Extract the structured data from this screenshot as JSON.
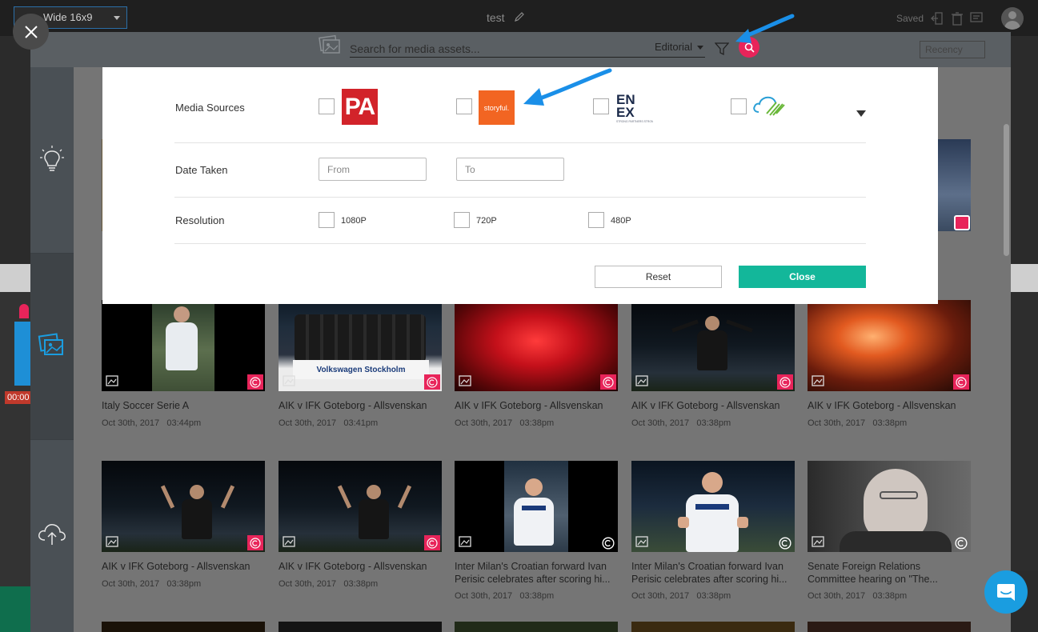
{
  "topbar": {
    "aspect_label": "Wide 16x9",
    "project_title": "test",
    "saved_label": "Saved"
  },
  "background": {
    "timecode": "00:00"
  },
  "search": {
    "placeholder": "Search for media assets...",
    "category": "Editorial",
    "sort": "Recency"
  },
  "filters": {
    "media_sources_label": "Media Sources",
    "sources": [
      {
        "name": "PA",
        "logo_text": "PA",
        "color": "#d2232a"
      },
      {
        "name": "Storyful",
        "logo_text": "storyful.",
        "color": "#f26522"
      },
      {
        "name": "ENEX",
        "logo_text": "ENEX",
        "color": "#1b2a4a",
        "tagline": "STRONG PARTNERS STRONG NEWS"
      },
      {
        "name": "Cloud source",
        "color": "#2a9fd6"
      }
    ],
    "date_taken_label": "Date Taken",
    "date_from_placeholder": "From",
    "date_to_placeholder": "To",
    "resolution_label": "Resolution",
    "resolutions": [
      "1080P",
      "720P",
      "480P"
    ],
    "reset_label": "Reset",
    "close_label": "Close"
  },
  "assets": [
    {
      "title": "Italy Soccer Serie A",
      "date": "Oct 30th, 2017",
      "time": "03:44pm"
    },
    {
      "title": "AIK v IFK Goteborg - Allsvenskan",
      "date": "Oct 30th, 2017",
      "time": "03:41pm",
      "banner": "Volkswagen Stockholm"
    },
    {
      "title": "AIK v IFK Goteborg - Allsvenskan",
      "date": "Oct 30th, 2017",
      "time": "03:38pm"
    },
    {
      "title": "AIK v IFK Goteborg - Allsvenskan",
      "date": "Oct 30th, 2017",
      "time": "03:38pm"
    },
    {
      "title": "AIK v IFK Goteborg - Allsvenskan",
      "date": "Oct 30th, 2017",
      "time": "03:38pm"
    },
    {
      "title": "AIK v IFK Goteborg - Allsvenskan",
      "date": "Oct 30th, 2017",
      "time": "03:38pm"
    },
    {
      "title": "AIK v IFK Goteborg - Allsvenskan",
      "date": "Oct 30th, 2017",
      "time": "03:38pm"
    },
    {
      "title": "Inter Milan's Croatian forward Ivan Perisic celebrates after scoring hi...",
      "date": "Oct 30th, 2017",
      "time": "03:38pm"
    },
    {
      "title": "Inter Milan's Croatian forward Ivan Perisic celebrates after scoring hi...",
      "date": "Oct 30th, 2017",
      "time": "03:38pm"
    },
    {
      "title": "Senate Foreign Relations Committee hearing on \"The...",
      "date": "Oct 30th, 2017",
      "time": "03:38pm"
    }
  ],
  "colors": {
    "accent_pink": "#e8245a",
    "close_green": "#13b79a",
    "annotation_blue": "#1a8fe8",
    "chat_blue": "#1a9de0"
  },
  "icons": {
    "rail": [
      "lightbulb-icon",
      "media-library-icon",
      "cloud-upload-icon"
    ]
  }
}
